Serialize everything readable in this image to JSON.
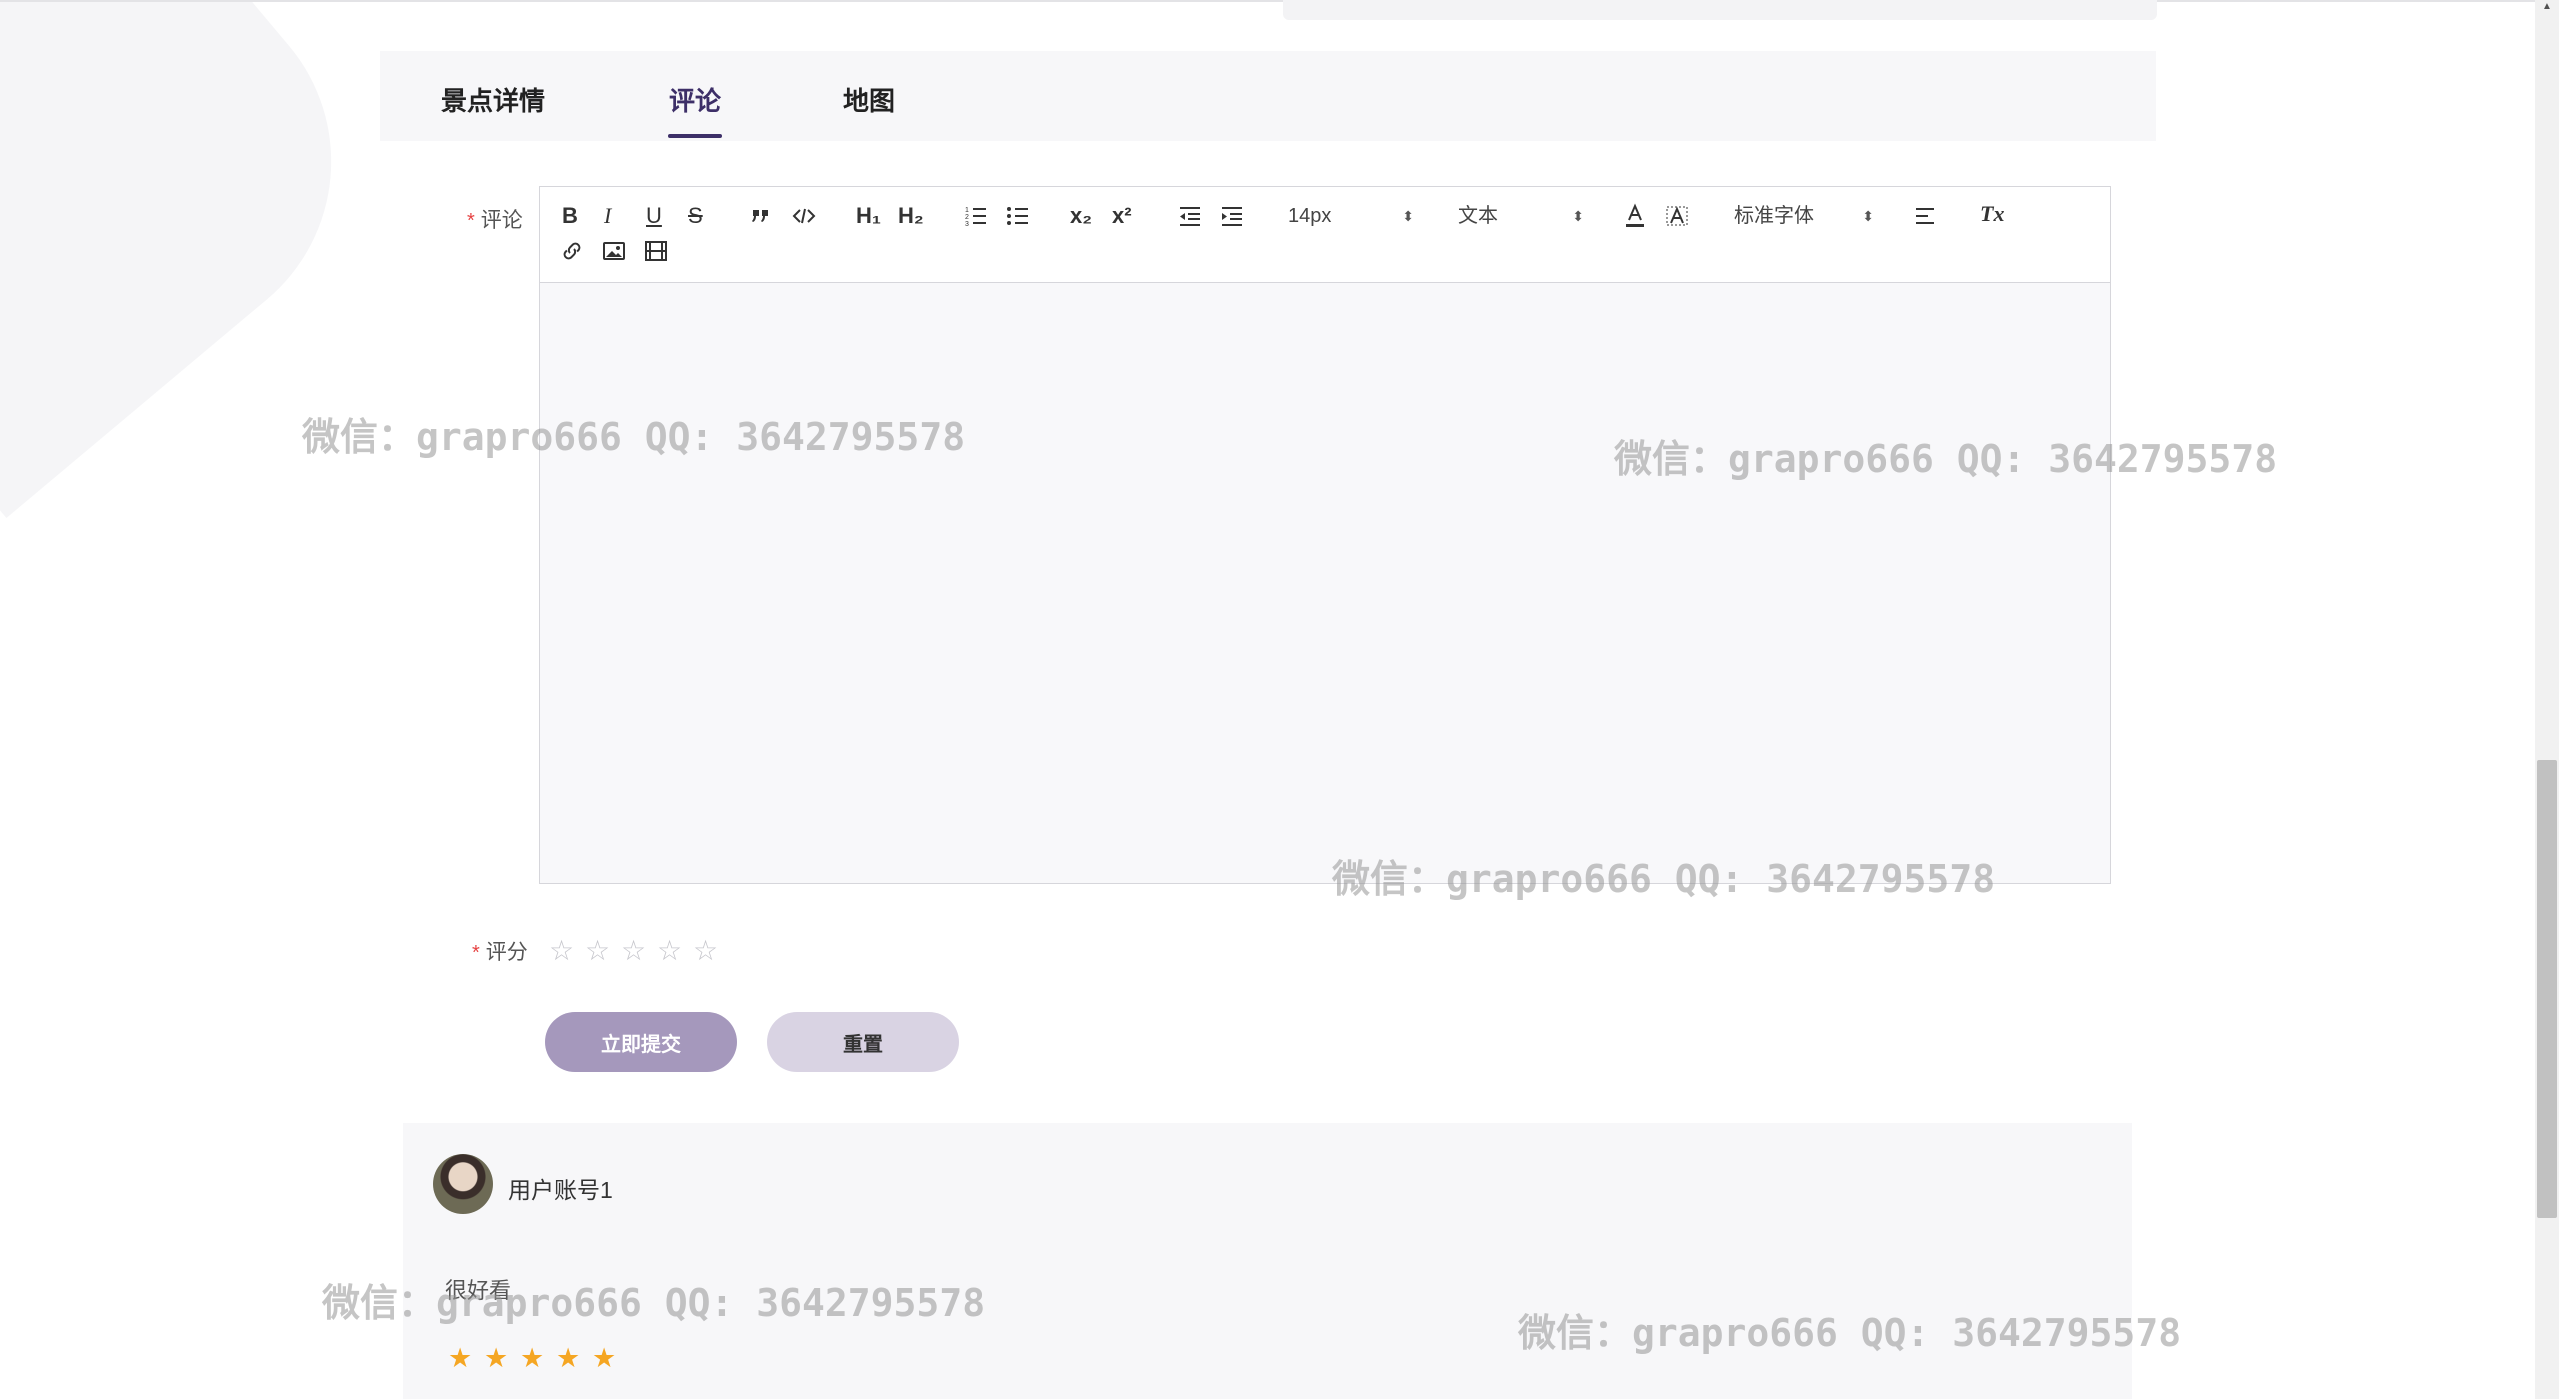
{
  "tabs": [
    {
      "label": "景点详情",
      "active": false
    },
    {
      "label": "评论",
      "active": true
    },
    {
      "label": "地图",
      "active": false
    }
  ],
  "form": {
    "comment_label": "评论",
    "rating_label": "评分",
    "required_mark": "*",
    "rating_value": 0,
    "rating_max": 5,
    "submit_label": "立即提交",
    "reset_label": "重置"
  },
  "toolbar": {
    "bold": "B",
    "italic": "I",
    "underline": "U",
    "strike": "S",
    "h1": "H₁",
    "h2": "H₂",
    "sub": "x₂",
    "sup": "x²",
    "size_value": "14px",
    "header_value": "文本",
    "font_value": "标准字体",
    "clean": "Tx",
    "icons": [
      "bold-icon",
      "italic-icon",
      "underline-icon",
      "strike-icon",
      "blockquote-icon",
      "code-block-icon",
      "h1-icon",
      "h2-icon",
      "ordered-list-icon",
      "bullet-list-icon",
      "subscript-icon",
      "superscript-icon",
      "outdent-icon",
      "indent-icon",
      "font-color-icon",
      "background-color-icon",
      "align-icon",
      "clean-format-icon",
      "link-icon",
      "image-icon",
      "video-icon"
    ]
  },
  "comment": {
    "username": "用户账号1",
    "text": "很好看",
    "rating": 5
  },
  "watermark": "微信：grapro666 QQ: 3642795578",
  "colors": {
    "accent": "#3d2f68",
    "submit_bg": "#a598bc",
    "reset_bg": "#d9d3e3",
    "required": "#e64242",
    "star_filled": "#f5a623",
    "star_empty": "#c6c6cc"
  }
}
